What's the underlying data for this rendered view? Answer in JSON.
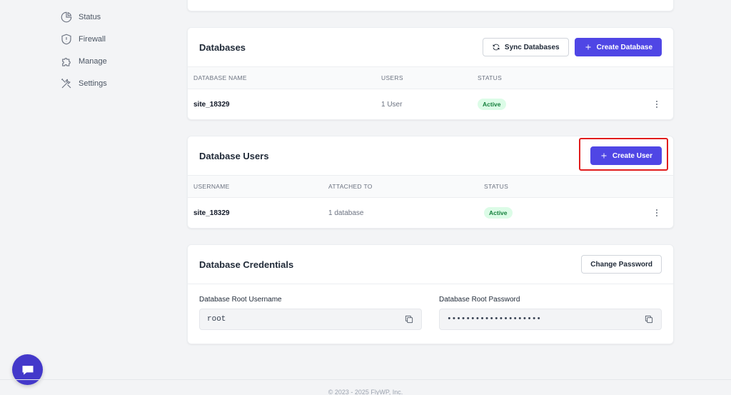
{
  "sidebar": {
    "items": [
      {
        "label": "Status",
        "icon": "pie-chart-icon"
      },
      {
        "label": "Firewall",
        "icon": "shield-icon"
      },
      {
        "label": "Manage",
        "icon": "puzzle-icon"
      },
      {
        "label": "Settings",
        "icon": "tools-icon"
      }
    ]
  },
  "databases": {
    "title": "Databases",
    "sync_label": "Sync Databases",
    "create_label": "Create Database",
    "columns": [
      "DATABASE NAME",
      "USERS",
      "STATUS"
    ],
    "rows": [
      {
        "name": "site_18329",
        "users": "1 User",
        "status": "Active"
      }
    ]
  },
  "db_users": {
    "title": "Database Users",
    "create_label": "Create User",
    "columns": [
      "USERNAME",
      "ATTACHED TO",
      "STATUS"
    ],
    "rows": [
      {
        "username": "site_18329",
        "attached": "1 database",
        "status": "Active"
      }
    ]
  },
  "credentials": {
    "title": "Database Credentials",
    "change_label": "Change Password",
    "username_label": "Database Root Username",
    "username_value": "root",
    "password_label": "Database Root Password",
    "password_value": "••••••••••••••••••••"
  },
  "footer": {
    "text": "© 2023 - 2025 FlyWP, Inc."
  },
  "colors": {
    "primary": "#4f46e5",
    "highlight": "#e11d1d",
    "badge_bg": "#dcfce7",
    "badge_text": "#15803d"
  }
}
